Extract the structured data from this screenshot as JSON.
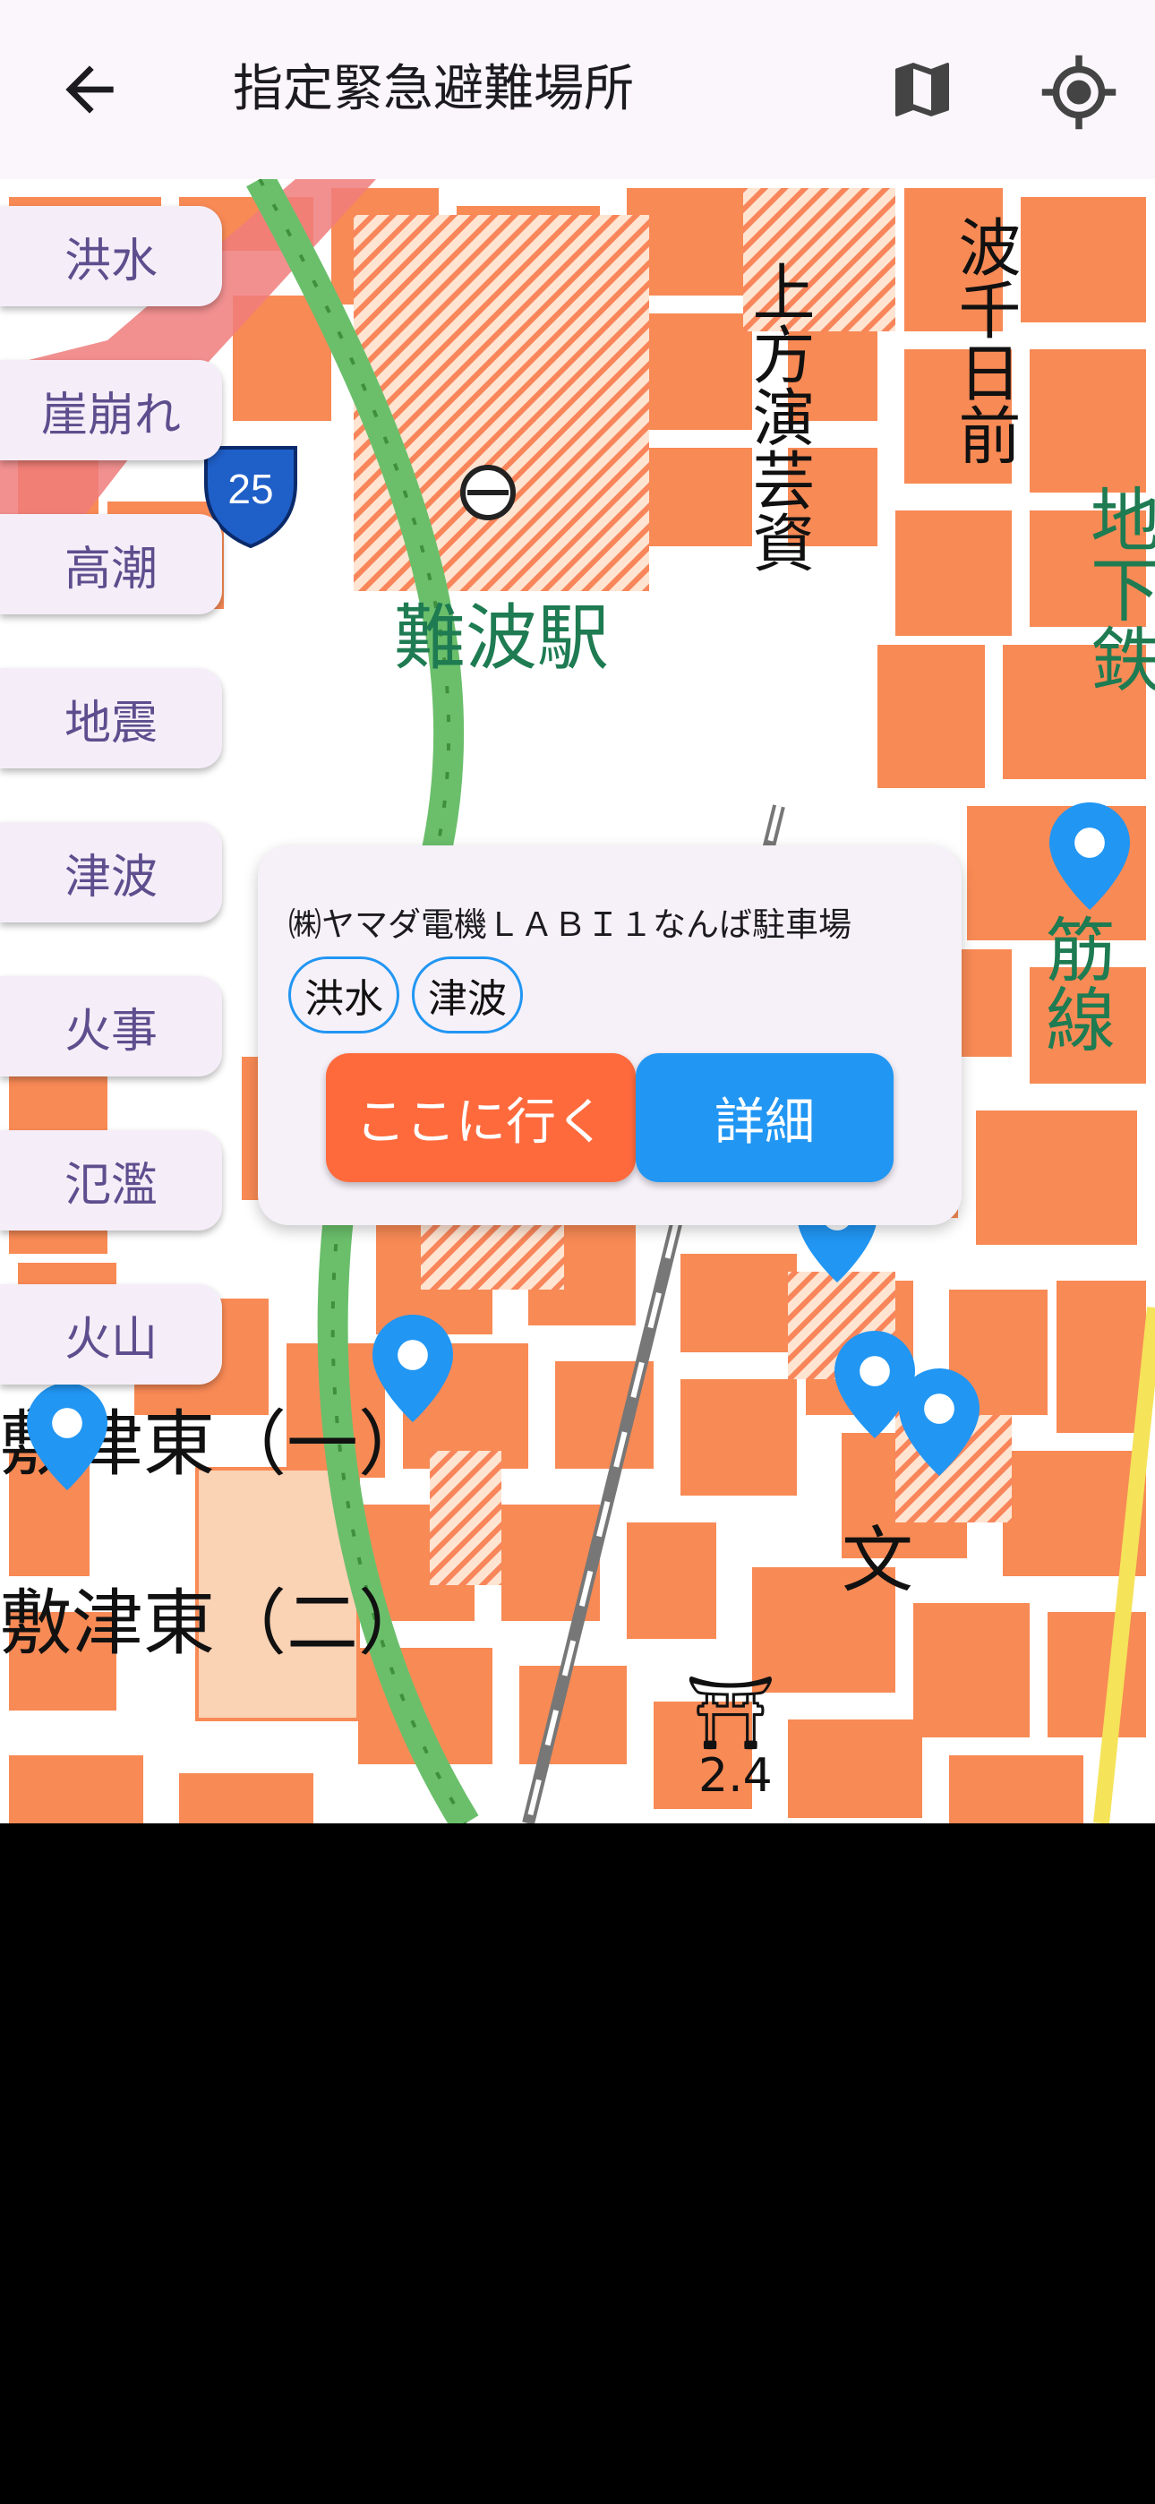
{
  "appbar": {
    "title": "指定緊急避難場所",
    "back_icon": "arrow-back-icon",
    "map_icon": "map-icon",
    "location_icon": "my-location-icon"
  },
  "filters": [
    "洪水",
    "崖崩れ",
    "高潮",
    "地震",
    "津波",
    "火事",
    "氾濫",
    "火山"
  ],
  "map": {
    "labels": {
      "station": "難波駅",
      "kamigata": "上方演芸資",
      "namba_sennichimae": "波千日前",
      "subway": "地下鉄",
      "line": "筋線",
      "shikitsu1": "敷津東（一）",
      "shikitsu2": "敷津東（二）",
      "route": "25",
      "elevation": "2.4"
    }
  },
  "popup": {
    "name": "㈱ヤマダ電機ＬＡＢＩ１なんば駐車場",
    "tags": [
      "洪水",
      "津波"
    ],
    "go_label": "ここに行く",
    "detail_label": "詳細"
  },
  "colors": {
    "accent": "#2196F3",
    "go": "#FF6A3D",
    "chip_text": "#5E4E8E",
    "map_block": "#F88A55"
  }
}
